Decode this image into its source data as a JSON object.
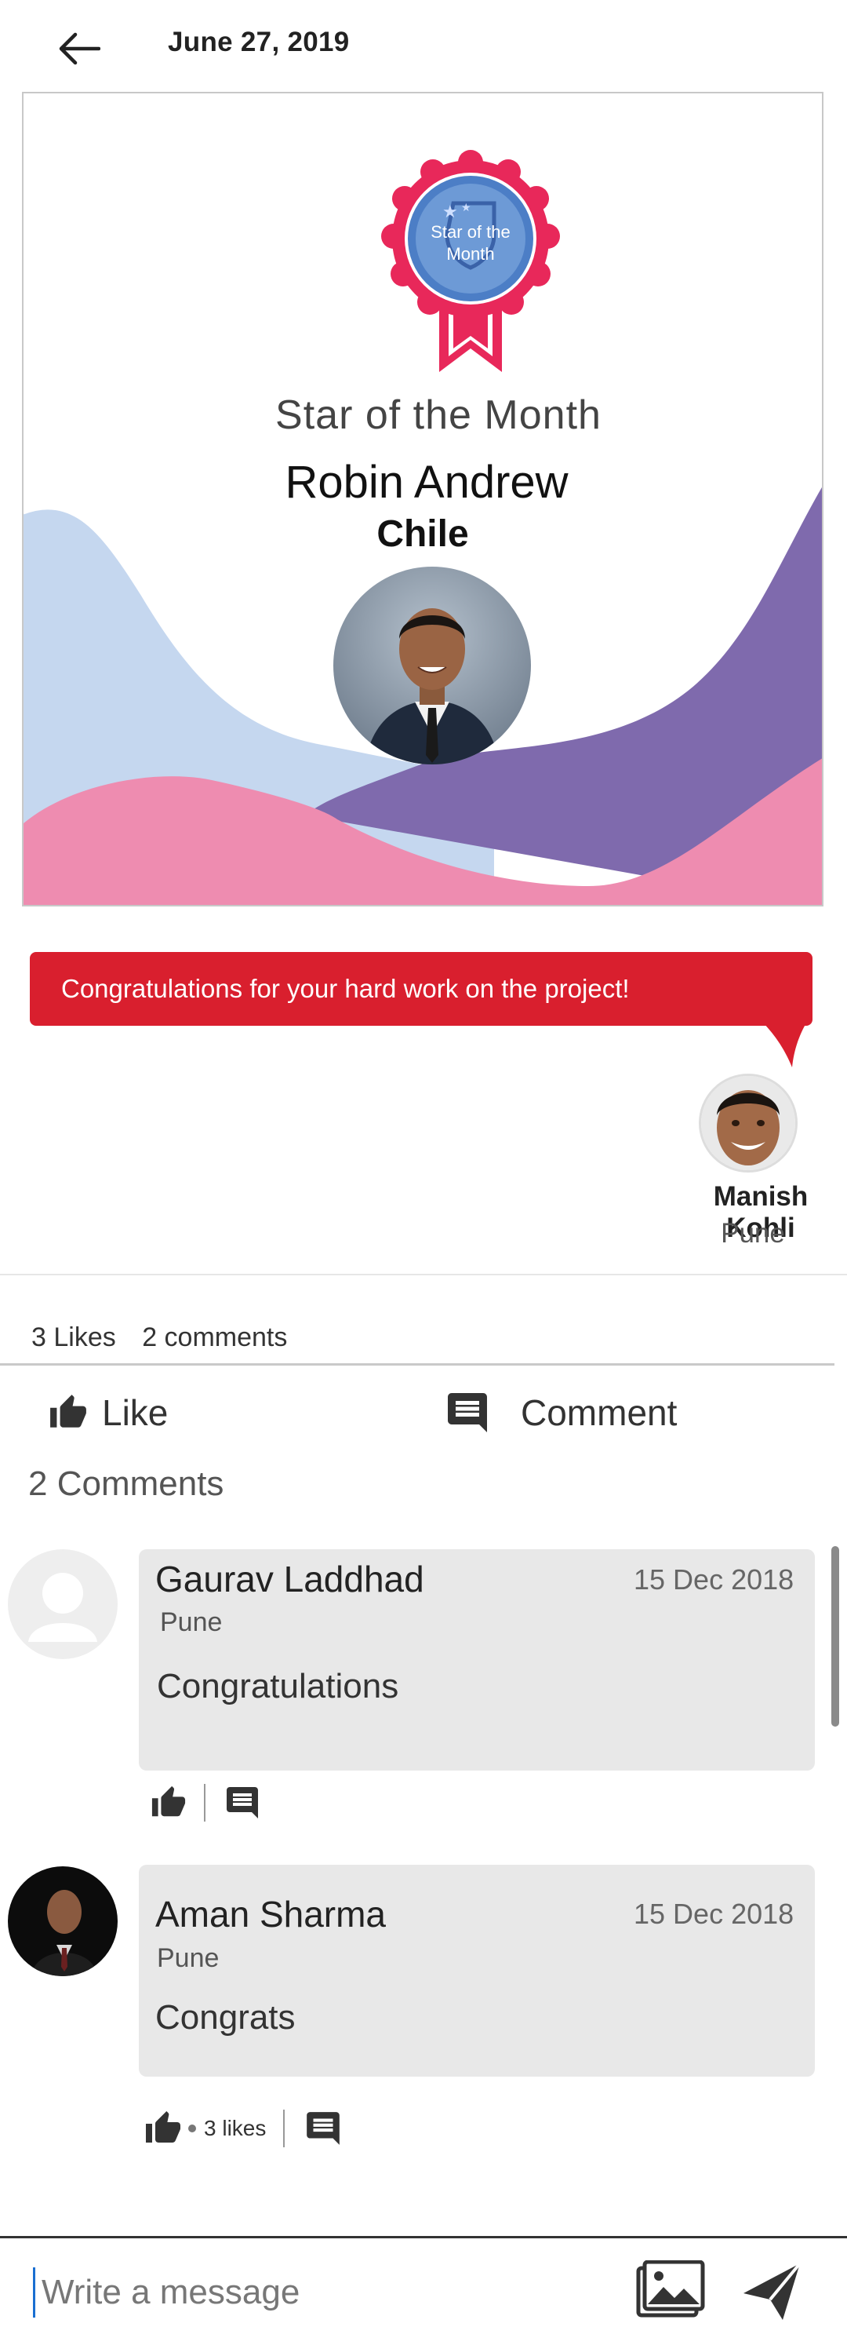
{
  "header": {
    "date": "June 27, 2019"
  },
  "card": {
    "badge_text_line1": "Star of the",
    "badge_text_line2": "Month",
    "award_title": "Star of the Month",
    "person_name": "Robin Andrew",
    "person_location": "Chile"
  },
  "message": {
    "text": "Congratulations for your hard work on the project!",
    "sender_name": "Manish Kohli",
    "sender_location": "Pune"
  },
  "stats": {
    "likes": "3 Likes",
    "comments": "2 comments"
  },
  "actions": {
    "like_label": "Like",
    "comment_label": "Comment"
  },
  "comments_header": "2 Comments",
  "comments": [
    {
      "name": "Gaurav Laddhad",
      "date": "15 Dec 2018",
      "location": "Pune",
      "text": "Congratulations",
      "likes": ""
    },
    {
      "name": "Aman Sharma",
      "date": "15 Dec 2018",
      "location": "Pune",
      "text": "Congrats",
      "likes": "3 likes"
    }
  ],
  "composer": {
    "placeholder": "Write a message"
  },
  "colors": {
    "accent_red": "#d91f2e",
    "wave_blue": "#c5d7ef",
    "wave_purple": "#7f6aad",
    "wave_pink": "#ee8cb0"
  }
}
